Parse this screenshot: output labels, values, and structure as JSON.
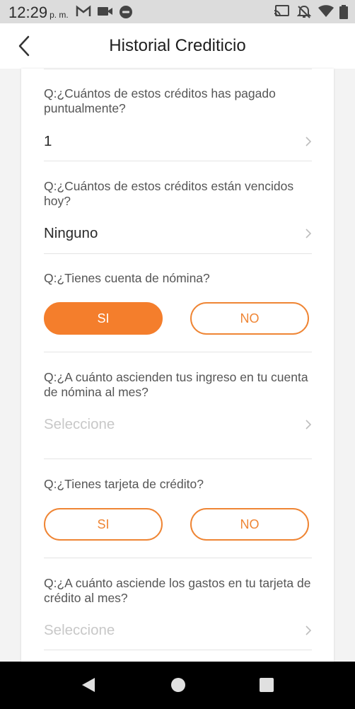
{
  "status_bar": {
    "time": "12:29",
    "ampm": "p. m."
  },
  "header": {
    "title": "Historial Crediticio"
  },
  "questions": [
    {
      "text": "Q:¿Cuántos de estos créditos has pagado puntualmente?",
      "value": "1"
    },
    {
      "text": "Q:¿Cuántos de estos créditos están vencidos hoy?",
      "value": "Ninguno"
    },
    {
      "text": "Q:¿Tienes cuenta de nómina?",
      "yes_label": "SI",
      "no_label": "NO",
      "selected": "yes"
    },
    {
      "text": "Q:¿A cuánto ascienden tus ingreso en tu cuenta de nómina al mes?",
      "placeholder": "Seleccione"
    },
    {
      "text": "Q:¿Tienes tarjeta de crédito?",
      "yes_label": "SI",
      "no_label": "NO",
      "selected": "none"
    },
    {
      "text": "Q:¿A cuánto asciende los gastos en tu tarjeta de crédito al mes?",
      "placeholder": "Seleccione"
    }
  ],
  "colors": {
    "accent": "#f47e2c",
    "accent_border": "#ef8534"
  }
}
